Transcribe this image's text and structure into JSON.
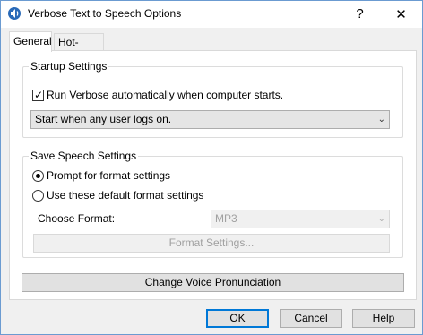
{
  "window": {
    "title": "Verbose Text to Speech Options",
    "help_label": "?",
    "close_label": "✕"
  },
  "tabs": [
    {
      "label": "General",
      "active": true
    },
    {
      "label": "Hot-Keys",
      "active": false
    }
  ],
  "startup": {
    "title": "Startup Settings",
    "run_checkbox_label": "Run Verbose automatically when computer starts.",
    "run_checked": true,
    "start_option_selected": "Start when any user logs on."
  },
  "save": {
    "title": "Save Speech Settings",
    "radio_prompt_label": "Prompt for format settings",
    "radio_default_label": "Use these default format settings",
    "selected": "prompt",
    "format_label": "Choose Format:",
    "format_selected": "MP3",
    "format_settings_button": "Format Settings..."
  },
  "change_voice_button": "Change Voice Pronunciation",
  "footer": {
    "ok": "OK",
    "cancel": "Cancel",
    "help": "Help"
  },
  "icons": {
    "dropdown_arrow": "chevron-down-icon",
    "app": "speaker-icon"
  }
}
